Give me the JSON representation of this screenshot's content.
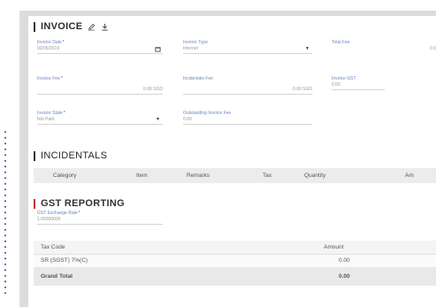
{
  "invoice": {
    "title": "INVOICE",
    "icons": [
      "pencil-icon",
      "download-icon"
    ],
    "fields": {
      "invoice_date": {
        "label": "Invoice Date",
        "required": true,
        "value": "02/05/2019"
      },
      "invoice_type": {
        "label": "Invoice Type",
        "value": "Internet"
      },
      "total_fee": {
        "label": "Total Fee",
        "value": "0.0"
      },
      "invoice_fee": {
        "label": "Invoice Fee",
        "required": true,
        "value": "0.00 SGD"
      },
      "incidentals_fee": {
        "label": "Incidentals Fee",
        "value": "0.00 SGD"
      },
      "invoice_gst": {
        "label": "Invoice GST",
        "value": "0.00"
      },
      "invoice_state": {
        "label": "Invoice State",
        "required": true,
        "value": "Not Paid"
      },
      "outstanding_invoice_fee": {
        "label": "Outstanding Invoice Fee",
        "value": "0.00"
      }
    }
  },
  "incidentals": {
    "title": "INCIDENTALS",
    "columns": [
      "Category",
      "Item",
      "Remarks",
      "Tax",
      "Quantity",
      "Am"
    ]
  },
  "gst_reporting": {
    "title": "GST REPORTING",
    "exchange_rate": {
      "label": "GST Exchange Rate",
      "required": true,
      "value": "1.00000000"
    },
    "columns": [
      "Tax Code",
      "Amount"
    ],
    "rows": [
      {
        "tax_code": "SR (SGST) 7%(C)",
        "amount": "0.00"
      }
    ],
    "total": {
      "label": "Grand Total",
      "amount": "0.00"
    }
  },
  "colors": {
    "label_blue": "#6a88c0",
    "gst_accent": "#c0392b",
    "dots": "#3a5fa6"
  }
}
